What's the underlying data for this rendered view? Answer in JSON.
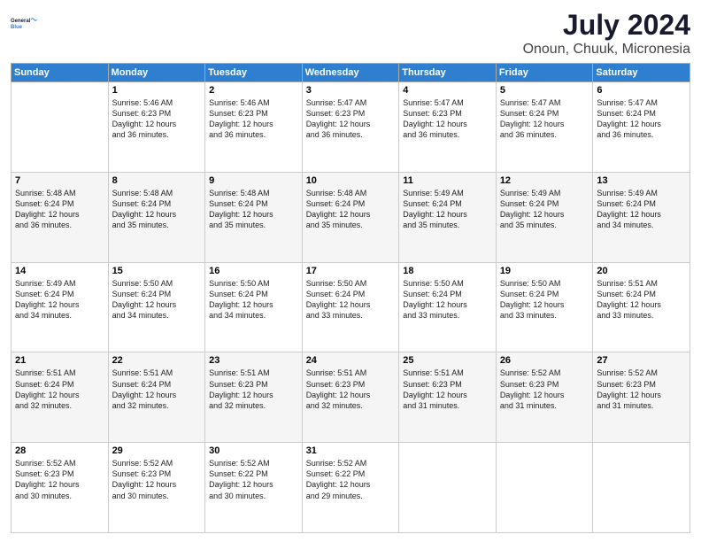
{
  "header": {
    "logo_line1": "General",
    "logo_line2": "Blue",
    "title": "July 2024",
    "subtitle": "Onoun, Chuuk, Micronesia"
  },
  "days_of_week": [
    "Sunday",
    "Monday",
    "Tuesday",
    "Wednesday",
    "Thursday",
    "Friday",
    "Saturday"
  ],
  "weeks": [
    [
      {
        "day": "",
        "info": ""
      },
      {
        "day": "1",
        "info": "Sunrise: 5:46 AM\nSunset: 6:23 PM\nDaylight: 12 hours\nand 36 minutes."
      },
      {
        "day": "2",
        "info": "Sunrise: 5:46 AM\nSunset: 6:23 PM\nDaylight: 12 hours\nand 36 minutes."
      },
      {
        "day": "3",
        "info": "Sunrise: 5:47 AM\nSunset: 6:23 PM\nDaylight: 12 hours\nand 36 minutes."
      },
      {
        "day": "4",
        "info": "Sunrise: 5:47 AM\nSunset: 6:23 PM\nDaylight: 12 hours\nand 36 minutes."
      },
      {
        "day": "5",
        "info": "Sunrise: 5:47 AM\nSunset: 6:24 PM\nDaylight: 12 hours\nand 36 minutes."
      },
      {
        "day": "6",
        "info": "Sunrise: 5:47 AM\nSunset: 6:24 PM\nDaylight: 12 hours\nand 36 minutes."
      }
    ],
    [
      {
        "day": "7",
        "info": "Sunrise: 5:48 AM\nSunset: 6:24 PM\nDaylight: 12 hours\nand 36 minutes."
      },
      {
        "day": "8",
        "info": "Sunrise: 5:48 AM\nSunset: 6:24 PM\nDaylight: 12 hours\nand 35 minutes."
      },
      {
        "day": "9",
        "info": "Sunrise: 5:48 AM\nSunset: 6:24 PM\nDaylight: 12 hours\nand 35 minutes."
      },
      {
        "day": "10",
        "info": "Sunrise: 5:48 AM\nSunset: 6:24 PM\nDaylight: 12 hours\nand 35 minutes."
      },
      {
        "day": "11",
        "info": "Sunrise: 5:49 AM\nSunset: 6:24 PM\nDaylight: 12 hours\nand 35 minutes."
      },
      {
        "day": "12",
        "info": "Sunrise: 5:49 AM\nSunset: 6:24 PM\nDaylight: 12 hours\nand 35 minutes."
      },
      {
        "day": "13",
        "info": "Sunrise: 5:49 AM\nSunset: 6:24 PM\nDaylight: 12 hours\nand 34 minutes."
      }
    ],
    [
      {
        "day": "14",
        "info": "Sunrise: 5:49 AM\nSunset: 6:24 PM\nDaylight: 12 hours\nand 34 minutes."
      },
      {
        "day": "15",
        "info": "Sunrise: 5:50 AM\nSunset: 6:24 PM\nDaylight: 12 hours\nand 34 minutes."
      },
      {
        "day": "16",
        "info": "Sunrise: 5:50 AM\nSunset: 6:24 PM\nDaylight: 12 hours\nand 34 minutes."
      },
      {
        "day": "17",
        "info": "Sunrise: 5:50 AM\nSunset: 6:24 PM\nDaylight: 12 hours\nand 33 minutes."
      },
      {
        "day": "18",
        "info": "Sunrise: 5:50 AM\nSunset: 6:24 PM\nDaylight: 12 hours\nand 33 minutes."
      },
      {
        "day": "19",
        "info": "Sunrise: 5:50 AM\nSunset: 6:24 PM\nDaylight: 12 hours\nand 33 minutes."
      },
      {
        "day": "20",
        "info": "Sunrise: 5:51 AM\nSunset: 6:24 PM\nDaylight: 12 hours\nand 33 minutes."
      }
    ],
    [
      {
        "day": "21",
        "info": "Sunrise: 5:51 AM\nSunset: 6:24 PM\nDaylight: 12 hours\nand 32 minutes."
      },
      {
        "day": "22",
        "info": "Sunrise: 5:51 AM\nSunset: 6:24 PM\nDaylight: 12 hours\nand 32 minutes."
      },
      {
        "day": "23",
        "info": "Sunrise: 5:51 AM\nSunset: 6:23 PM\nDaylight: 12 hours\nand 32 minutes."
      },
      {
        "day": "24",
        "info": "Sunrise: 5:51 AM\nSunset: 6:23 PM\nDaylight: 12 hours\nand 32 minutes."
      },
      {
        "day": "25",
        "info": "Sunrise: 5:51 AM\nSunset: 6:23 PM\nDaylight: 12 hours\nand 31 minutes."
      },
      {
        "day": "26",
        "info": "Sunrise: 5:52 AM\nSunset: 6:23 PM\nDaylight: 12 hours\nand 31 minutes."
      },
      {
        "day": "27",
        "info": "Sunrise: 5:52 AM\nSunset: 6:23 PM\nDaylight: 12 hours\nand 31 minutes."
      }
    ],
    [
      {
        "day": "28",
        "info": "Sunrise: 5:52 AM\nSunset: 6:23 PM\nDaylight: 12 hours\nand 30 minutes."
      },
      {
        "day": "29",
        "info": "Sunrise: 5:52 AM\nSunset: 6:23 PM\nDaylight: 12 hours\nand 30 minutes."
      },
      {
        "day": "30",
        "info": "Sunrise: 5:52 AM\nSunset: 6:22 PM\nDaylight: 12 hours\nand 30 minutes."
      },
      {
        "day": "31",
        "info": "Sunrise: 5:52 AM\nSunset: 6:22 PM\nDaylight: 12 hours\nand 29 minutes."
      },
      {
        "day": "",
        "info": ""
      },
      {
        "day": "",
        "info": ""
      },
      {
        "day": "",
        "info": ""
      }
    ]
  ]
}
